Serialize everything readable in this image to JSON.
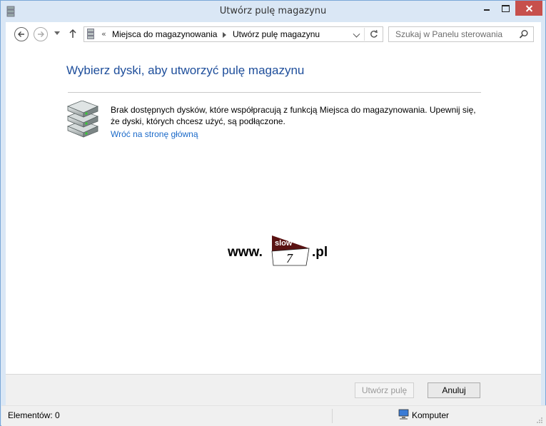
{
  "window": {
    "title": "Utwórz pulę magazynu",
    "controls": [
      "minimize",
      "maximize",
      "close"
    ]
  },
  "navigation": {
    "breadcrumb": [
      "Miejsca do magazynowania",
      "Utwórz pulę magazynu"
    ],
    "breadcrumb_prefix": "«",
    "search_placeholder": "Szukaj w Panelu sterowania"
  },
  "main": {
    "heading": "Wybierz dyski, aby utworzyć pulę magazynu",
    "message": "Brak dostępnych dysków, które współpracują z funkcją Miejsca do magazynowania. Upewnij się, że dyski, których chcesz użyć, są podłączone.",
    "link": "Wróć na stronę główną"
  },
  "watermark": {
    "prefix": "www.",
    "logo_top": "slow",
    "logo_num": "7",
    "suffix": ".pl"
  },
  "footer": {
    "create_button": "Utwórz pulę",
    "cancel_button": "Anuluj"
  },
  "statusbar": {
    "items_count": "Elementów: 0",
    "location": "Komputer"
  },
  "colors": {
    "heading": "#1e4e9b",
    "link": "#1b6ac9",
    "close_button": "#c7504c",
    "window_frame": "#dae7f5"
  }
}
